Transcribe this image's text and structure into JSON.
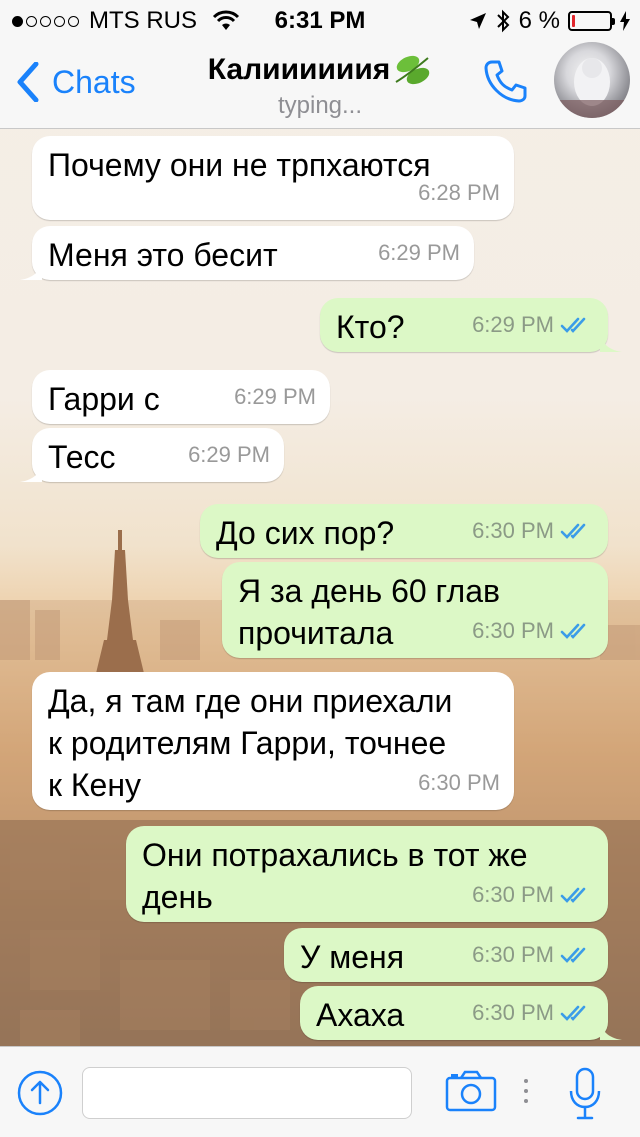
{
  "status_bar": {
    "signal_filled": 1,
    "signal_total": 5,
    "carrier": "MTS RUS",
    "time": "6:31 PM",
    "battery_percent": "6 %",
    "battery_level": 0.06
  },
  "nav": {
    "back_label": "Chats",
    "contact_name": "Калиииииия",
    "status": "typing...",
    "icons": [
      "chevron-left-icon",
      "leaf-emoji-icon",
      "phone-icon",
      "avatar"
    ]
  },
  "messages": [
    {
      "side": "in",
      "text": "Почему они не трпхаются",
      "time": "6:28 PM"
    },
    {
      "side": "in",
      "text": "Меня это бесит",
      "time": "6:29 PM"
    },
    {
      "side": "out",
      "text": "Кто?",
      "time": "6:29 PM",
      "read": true
    },
    {
      "side": "in",
      "text": "Гарри с",
      "time": "6:29 PM"
    },
    {
      "side": "in",
      "text": "Тесс",
      "time": "6:29 PM"
    },
    {
      "side": "out",
      "text": "До сих пор?",
      "time": "6:30 PM",
      "read": true
    },
    {
      "side": "out",
      "text": "Я за день 60 глав\nпрочитала",
      "time": "6:30 PM",
      "read": true
    },
    {
      "side": "in",
      "text": "Да, я там где они приехали\nк родителям Гарри, точнее\nк Кену",
      "time": "6:30 PM"
    },
    {
      "side": "out",
      "text": "Они потрахались в тот же\nдень",
      "time": "6:30 PM",
      "read": true
    },
    {
      "side": "out",
      "text": "У меня",
      "time": "6:30 PM",
      "read": true
    },
    {
      "side": "out",
      "text": "Ахаха",
      "time": "6:30 PM",
      "read": true
    }
  ],
  "input_bar": {
    "placeholder": "",
    "value": "",
    "icons": [
      "upload-icon",
      "camera-icon",
      "more-icon",
      "microphone-icon"
    ]
  },
  "colors": {
    "accent": "#1a82fb",
    "incoming_bubble": "#ffffff",
    "outgoing_bubble": "#dcf8c6",
    "read_ticks": "#3b9ce8",
    "battery_low": "#e0262b"
  }
}
